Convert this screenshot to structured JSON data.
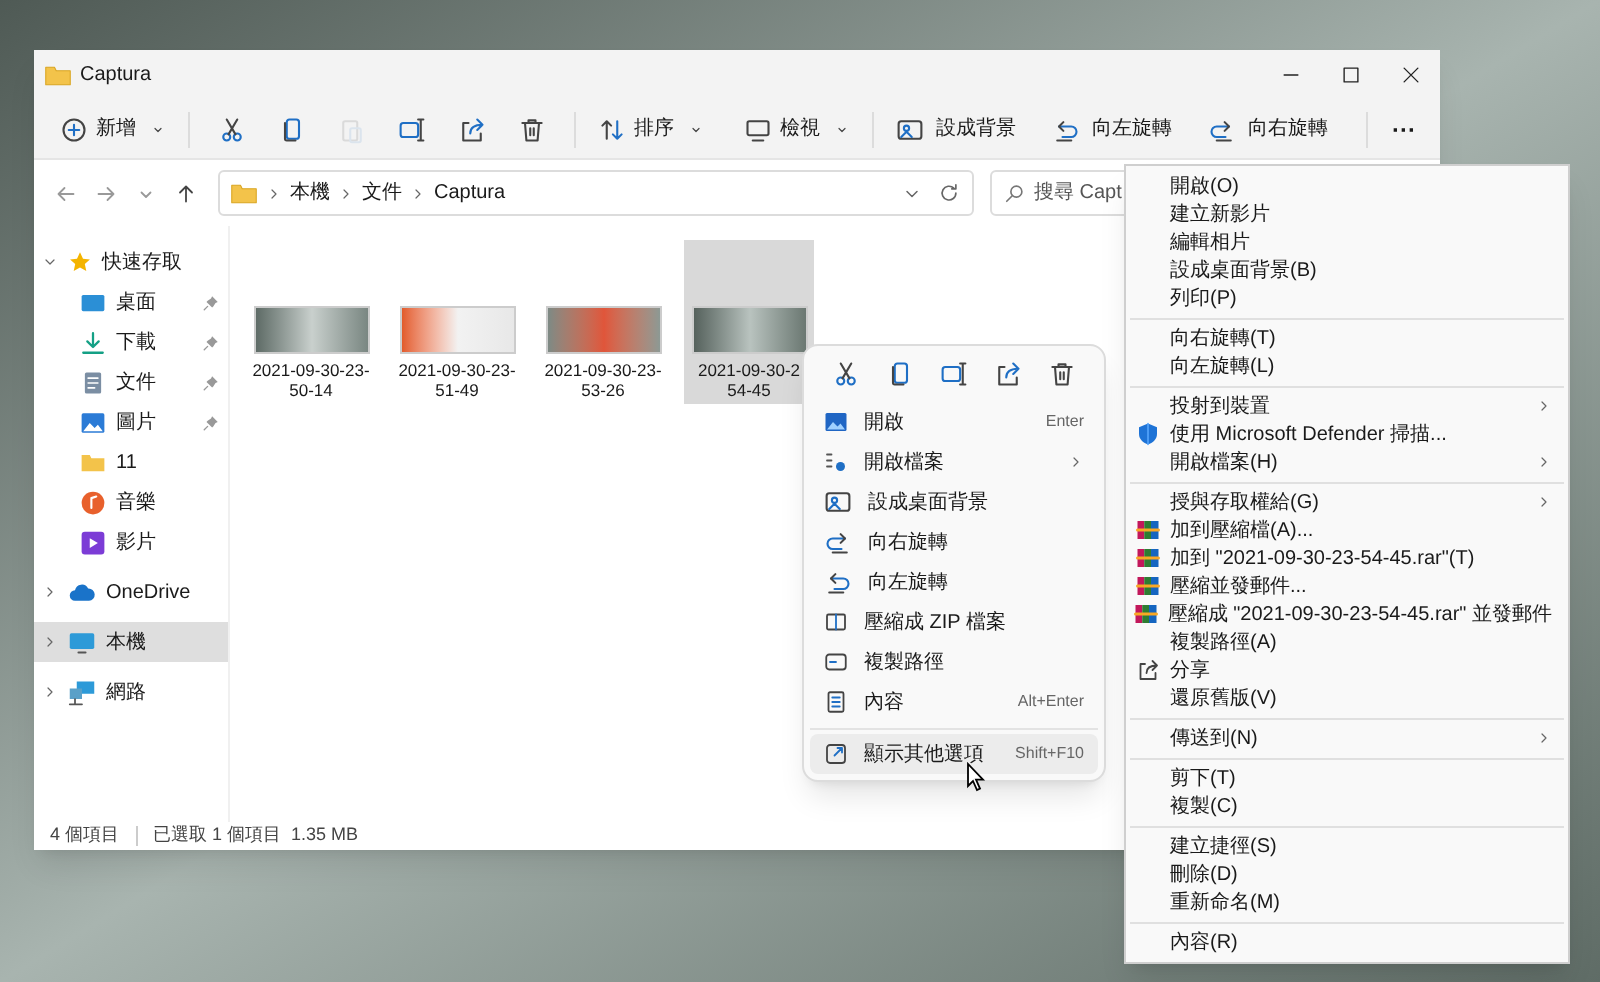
{
  "window": {
    "title": "Captura"
  },
  "toolbar": {
    "new_button": "新增",
    "icon_buttons": [
      {
        "disabled": false
      },
      {
        "disabled": false
      },
      {
        "disabled": true
      },
      {
        "disabled": false
      },
      {
        "disabled": false
      },
      {
        "disabled": false
      }
    ],
    "sort_button": "排序",
    "view_button": "檢視",
    "actions": [
      "設成背景",
      "向左旋轉",
      "向右旋轉"
    ],
    "more_button": "···"
  },
  "address_bar": {
    "crumbs": [
      "本機",
      "文件",
      "Captura"
    ]
  },
  "search": {
    "placeholder": "搜尋 Capt"
  },
  "sidebar": {
    "items": [
      {
        "label": "快速存取",
        "expanded": true,
        "selected": false,
        "children": [
          {
            "label": "桌面",
            "pinned": true,
            "selected": false
          },
          {
            "label": "下載",
            "pinned": true,
            "selected": false
          },
          {
            "label": "文件",
            "pinned": true,
            "selected": false
          },
          {
            "label": "圖片",
            "pinned": true,
            "selected": false
          },
          {
            "label": "11",
            "pinned": false,
            "selected": false
          },
          {
            "label": "音樂",
            "pinned": false,
            "selected": false
          },
          {
            "label": "影片",
            "pinned": false,
            "selected": false
          }
        ]
      },
      {
        "label": "OneDrive",
        "expanded": false,
        "selected": false
      },
      {
        "label": "本機",
        "expanded": false,
        "selected": true
      },
      {
        "label": "網路",
        "expanded": false,
        "selected": false
      }
    ]
  },
  "files": [
    {
      "name_lines": [
        "2021-09-30-23-",
        "50-14"
      ],
      "selected": false
    },
    {
      "name_lines": [
        "2021-09-30-23-",
        "51-49"
      ],
      "selected": false
    },
    {
      "name_lines": [
        "2021-09-30-23-",
        "53-26"
      ],
      "selected": false
    },
    {
      "name_lines": [
        "2021-09-30-2",
        "54-45"
      ],
      "selected": true
    }
  ],
  "status_bar": {
    "count": "4 個項目",
    "selection": "已選取 1 個項目",
    "size": "1.35 MB"
  },
  "context_menu": {
    "items": [
      {
        "kind": "item",
        "label": "開啟",
        "shortcut": "Enter",
        "submenu": false,
        "selected": false
      },
      {
        "kind": "item",
        "label": "開啟檔案",
        "submenu": true,
        "selected": false
      },
      {
        "kind": "item",
        "label": "設成桌面背景",
        "submenu": false,
        "selected": false
      },
      {
        "kind": "item",
        "label": "向右旋轉",
        "submenu": false,
        "selected": false
      },
      {
        "kind": "item",
        "label": "向左旋轉",
        "submenu": false,
        "selected": false
      },
      {
        "kind": "item",
        "label": "壓縮成 ZIP 檔案",
        "submenu": false,
        "selected": false
      },
      {
        "kind": "item",
        "label": "複製路徑",
        "submenu": false,
        "selected": false
      },
      {
        "kind": "item",
        "label": "內容",
        "shortcut": "Alt+Enter",
        "submenu": false,
        "selected": false
      },
      {
        "kind": "separator"
      },
      {
        "kind": "item",
        "label": "顯示其他選項",
        "shortcut": "Shift+F10",
        "submenu": false,
        "selected": true
      }
    ]
  },
  "classic_menu": {
    "items": [
      {
        "kind": "item",
        "label": "開啟(O)",
        "submenu": false
      },
      {
        "kind": "item",
        "label": "建立新影片",
        "submenu": false
      },
      {
        "kind": "item",
        "label": "編輯相片",
        "submenu": false
      },
      {
        "kind": "item",
        "label": "設成桌面背景(B)",
        "submenu": false
      },
      {
        "kind": "item",
        "label": "列印(P)",
        "submenu": false
      },
      {
        "kind": "separator"
      },
      {
        "kind": "item",
        "label": "向右旋轉(T)",
        "submenu": false
      },
      {
        "kind": "item",
        "label": "向左旋轉(L)",
        "submenu": false
      },
      {
        "kind": "separator"
      },
      {
        "kind": "item",
        "label": "投射到裝置",
        "submenu": true
      },
      {
        "kind": "item",
        "label": "使用 Microsoft Defender 掃描...",
        "submenu": false
      },
      {
        "kind": "item",
        "label": "開啟檔案(H)",
        "submenu": true
      },
      {
        "kind": "separator"
      },
      {
        "kind": "item",
        "label": "授與存取權給(G)",
        "submenu": true
      },
      {
        "kind": "item",
        "label": "加到壓縮檔(A)...",
        "submenu": false
      },
      {
        "kind": "item",
        "label": "加到 \"2021-09-30-23-54-45.rar\"(T)",
        "submenu": false
      },
      {
        "kind": "item",
        "label": "壓縮並發郵件...",
        "submenu": false
      },
      {
        "kind": "item",
        "label": "壓縮成 \"2021-09-30-23-54-45.rar\" 並發郵件",
        "submenu": false
      },
      {
        "kind": "item",
        "label": "複製路徑(A)",
        "submenu": false
      },
      {
        "kind": "item",
        "label": "分享",
        "submenu": false
      },
      {
        "kind": "item",
        "label": "還原舊版(V)",
        "submenu": false
      },
      {
        "kind": "separator"
      },
      {
        "kind": "item",
        "label": "傳送到(N)",
        "submenu": true
      },
      {
        "kind": "separator"
      },
      {
        "kind": "item",
        "label": "剪下(T)",
        "submenu": false
      },
      {
        "kind": "item",
        "label": "複製(C)",
        "submenu": false
      },
      {
        "kind": "separator"
      },
      {
        "kind": "item",
        "label": "建立捷徑(S)",
        "submenu": false
      },
      {
        "kind": "item",
        "label": "刪除(D)",
        "submenu": false
      },
      {
        "kind": "item",
        "label": "重新命名(M)",
        "submenu": false
      },
      {
        "kind": "separator"
      },
      {
        "kind": "item",
        "label": "內容(R)",
        "submenu": false
      }
    ]
  }
}
